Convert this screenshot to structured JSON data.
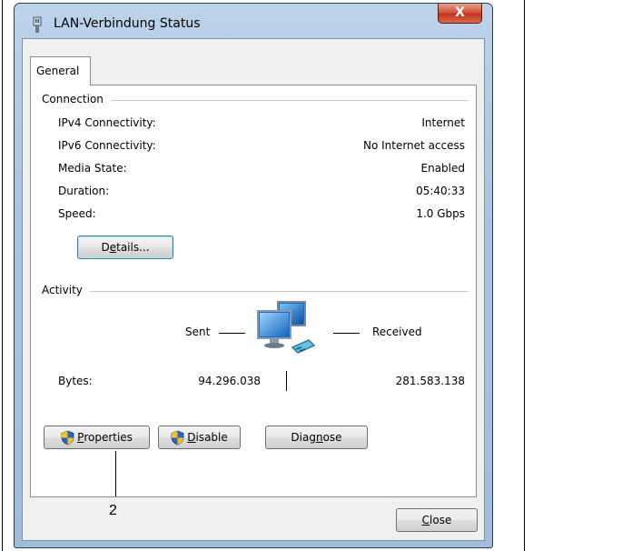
{
  "window": {
    "title": "LAN-Verbindung Status",
    "close_label": "X"
  },
  "tabs": [
    {
      "label": "General"
    }
  ],
  "connection": {
    "group_label": "Connection",
    "rows": [
      {
        "label": "IPv4 Connectivity:",
        "value": "Internet"
      },
      {
        "label": "IPv6 Connectivity:",
        "value": "No Internet access"
      },
      {
        "label": "Media State:",
        "value": "Enabled"
      },
      {
        "label": "Duration:",
        "value": "05:40:33"
      },
      {
        "label": "Speed:",
        "value": "1.0 Gbps"
      }
    ],
    "details_button": {
      "pre": "D",
      "ul": "e",
      "post": "tails..."
    }
  },
  "activity": {
    "group_label": "Activity",
    "sent_label": "Sent",
    "received_label": "Received",
    "bytes_label": "Bytes:",
    "bytes_sent": "94.296.038",
    "bytes_received": "281.583.138"
  },
  "buttons": {
    "properties": {
      "ul": "P",
      "post": "roperties"
    },
    "disable": {
      "ul": "D",
      "post": "isable"
    },
    "diagnose": {
      "pre": "Diag",
      "ul": "n",
      "post": "ose"
    },
    "close": {
      "ul": "C",
      "post": "lose"
    }
  },
  "callout": {
    "number": "2"
  },
  "colors": {
    "title_bar": "#a9c4df",
    "close_red": "#c0341c",
    "focus_blue": "#3c7fb1"
  }
}
